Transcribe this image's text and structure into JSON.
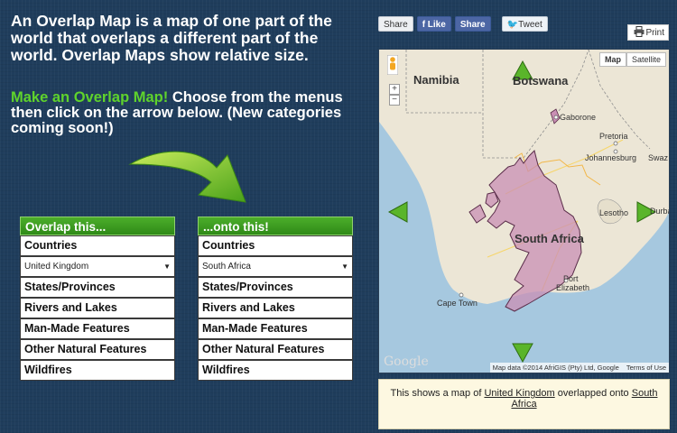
{
  "intro": {
    "text": "An Overlap Map is a map of one part of the world that overlaps a different part of the world. Overlap Maps show relative size."
  },
  "instructions": {
    "highlight": "Make an Overlap Map!",
    "rest": " Choose from the menus then click on the arrow below. (New categories coming soon!)"
  },
  "left_menu": {
    "header": "Overlap this...",
    "categories": [
      "Countries",
      "States/Provinces",
      "Rivers and Lakes",
      "Man-Made Features",
      "Other Natural Features",
      "Wildfires"
    ],
    "selected": "United Kingdom"
  },
  "right_menu": {
    "header": "...onto this!",
    "categories": [
      "Countries",
      "States/Provinces",
      "Rivers and Lakes",
      "Man-Made Features",
      "Other Natural Features",
      "Wildfires"
    ],
    "selected": "South Africa"
  },
  "share": {
    "share1": "Share",
    "like": "Like",
    "share2": "Share",
    "tweet": "Tweet",
    "print": "Print"
  },
  "map": {
    "type_map": "Map",
    "type_satellite": "Satellite",
    "zoom_in": "+",
    "zoom_out": "−",
    "places": {
      "namibia": "Namibia",
      "botswana": "Botswana",
      "gaborone": "Gaborone",
      "pretoria": "Pretoria",
      "johannesburg": "Johannesburg",
      "swaz": "Swaz",
      "lesotho": "Lesotho",
      "durba": "Durba",
      "south_africa": "South Africa",
      "port_elizabeth_1": "Port",
      "port_elizabeth_2": "Elizabeth",
      "cape_town": "Cape Town"
    },
    "google": "Google",
    "map_data": "Map data ©2014 AfriGIS (Pty) Ltd, Google",
    "terms": "Terms of Use",
    "colors": {
      "water": "#a6c8df",
      "land": "#ece6d6",
      "overlay": "#c98fb4"
    }
  },
  "caption": {
    "prefix": "This shows a map of ",
    "source": "United Kingdom",
    "middle": " overlapped onto ",
    "target": "South Africa"
  }
}
